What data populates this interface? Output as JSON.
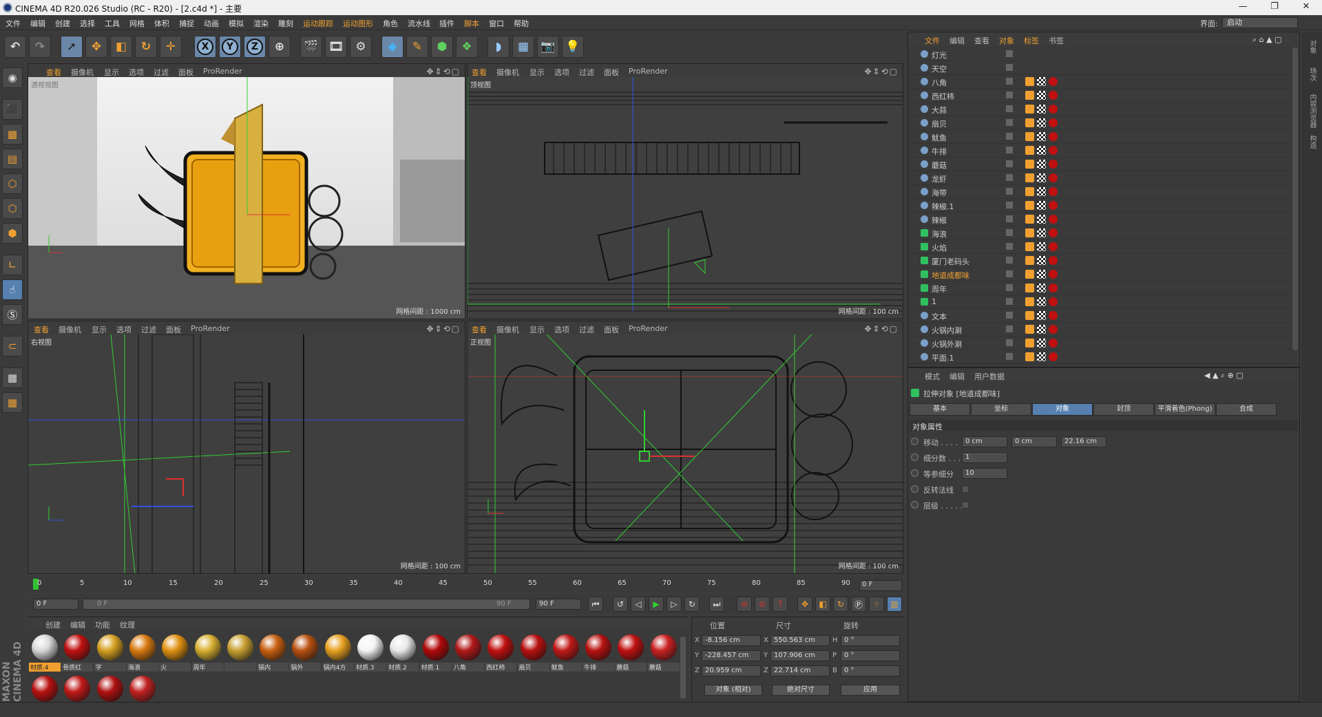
{
  "window": {
    "title": "CINEMA 4D R20.026 Studio (RC - R20) - [2.c4d *] - 主要",
    "minimize": "—",
    "maximize": "❐",
    "close": "✕"
  },
  "menu": [
    "文件",
    "编辑",
    "创建",
    "选择",
    "工具",
    "网格",
    "体积",
    "捕捉",
    "动画",
    "模拟",
    "渲染",
    "雕刻",
    "运动跟踪",
    "运动图形",
    "角色",
    "流水线",
    "插件",
    "脚本",
    "窗口",
    "帮助"
  ],
  "layout": {
    "label": "界面:",
    "value": "启动"
  },
  "toolbar": {
    "undo": "↶",
    "redo": "↷",
    "x": "X",
    "y": "Y",
    "z": "Z"
  },
  "viewport_menu": [
    "查看",
    "摄像机",
    "显示",
    "选项",
    "过滤",
    "面板",
    "ProRender"
  ],
  "viewports": [
    {
      "name": "透视视图",
      "grid": "网格间距 : 1000 cm"
    },
    {
      "name": "顶视图",
      "grid": "网格间距 : 100 cm"
    },
    {
      "name": "右视图",
      "grid": "网格间距 : 100 cm"
    },
    {
      "name": "正视图",
      "grid": "网格间距 : 100 cm"
    }
  ],
  "timeline": {
    "ticks": [
      "0",
      "5",
      "10",
      "15",
      "20",
      "25",
      "30",
      "35",
      "40",
      "45",
      "50",
      "55",
      "60",
      "65",
      "70",
      "75",
      "80",
      "85",
      "90"
    ],
    "current": "0 F"
  },
  "transport": {
    "start": "0 F",
    "slider_start": "0 F",
    "slider_end": "90 F",
    "end": "90 F"
  },
  "materials": {
    "menu": [
      "创建",
      "编辑",
      "功能",
      "纹理"
    ],
    "items": [
      {
        "label": "材质.4",
        "color": "#d8d8d8"
      },
      {
        "label": "骨质红",
        "color": "#c01010"
      },
      {
        "label": "字",
        "color": "#d4a020"
      },
      {
        "label": "海浪",
        "color": "#d87a10"
      },
      {
        "label": "火",
        "color": "#e09010"
      },
      {
        "label": "周年",
        "color": "#d8b030"
      },
      {
        "label": "",
        "color": "#c8a030"
      },
      {
        "label": "锅内",
        "color": "#c86010"
      },
      {
        "label": "锅外",
        "color": "#b85010"
      },
      {
        "label": "锅内4方",
        "color": "#e8a020"
      },
      {
        "label": "材质.3",
        "color": "#f4f4f4"
      },
      {
        "label": "材质.2",
        "color": "#e8e8e8"
      },
      {
        "label": "材质.1",
        "color": "#b00808"
      },
      {
        "label": "八角",
        "color": "#b01818"
      },
      {
        "label": "西红柿",
        "color": "#c01010"
      },
      {
        "label": "扇贝",
        "color": "#b81010"
      },
      {
        "label": "鱿鱼",
        "color": "#c01818"
      },
      {
        "label": "牛排",
        "color": "#b81010"
      },
      {
        "label": "蘑菇",
        "color": "#c01010"
      },
      {
        "label": "蘑菇",
        "color": "#c82020"
      }
    ],
    "row2": [
      {
        "label": "",
        "color": "#b81010"
      },
      {
        "label": "",
        "color": "#c01818"
      },
      {
        "label": "",
        "color": "#b01010"
      },
      {
        "label": "",
        "color": "#c02020"
      }
    ]
  },
  "coords": {
    "headers": [
      "位置",
      "尺寸",
      "旋转"
    ],
    "rows": [
      {
        "axis": "X",
        "pos": "-8.156 cm",
        "size_axis": "X",
        "size": "550.563 cm",
        "rot_axis": "H",
        "rot": "0 °"
      },
      {
        "axis": "Y",
        "pos": "-228.457 cm",
        "size_axis": "Y",
        "size": "107.906 cm",
        "rot_axis": "P",
        "rot": "0 °"
      },
      {
        "axis": "Z",
        "pos": "20.959 cm",
        "size_axis": "Z",
        "size": "22.714 cm",
        "rot_axis": "B",
        "rot": "0 °"
      }
    ],
    "mode": "对象 (相对)",
    "size_mode": "绝对尺寸",
    "apply": "应用"
  },
  "objmgr": {
    "menu": [
      "文件",
      "编辑",
      "查看",
      "对象",
      "标签",
      "书签"
    ],
    "rows": [
      {
        "name": "灯光"
      },
      {
        "name": "天空"
      },
      {
        "name": "八角"
      },
      {
        "name": "西红柿"
      },
      {
        "name": "大蒜"
      },
      {
        "name": "扇贝"
      },
      {
        "name": "鱿鱼"
      },
      {
        "name": "牛排"
      },
      {
        "name": "蘑菇"
      },
      {
        "name": "龙虾"
      },
      {
        "name": "海带"
      },
      {
        "name": "辣椒.1"
      },
      {
        "name": "辣椒"
      },
      {
        "name": "海浪"
      },
      {
        "name": "火焰"
      },
      {
        "name": "厦门老码头"
      },
      {
        "name": "地道成都味"
      },
      {
        "name": "周年"
      },
      {
        "name": "1"
      },
      {
        "name": "文本"
      },
      {
        "name": "火锅内涮"
      },
      {
        "name": "火锅外涮"
      },
      {
        "name": "平面.1"
      }
    ]
  },
  "attr": {
    "menu": [
      "模式",
      "编辑",
      "用户数据"
    ],
    "title": "拉伸对象 [地道成都味]",
    "tabs": [
      "基本",
      "坐标",
      "对象",
      "封顶",
      "平滑着色(Phong)",
      "合成"
    ],
    "section": "对象属性",
    "move_label": "移动 . . . .",
    "move": [
      "0 cm",
      "0 cm",
      "22.16 cm"
    ],
    "subdiv_label": "细分数 . . .",
    "subdiv": "1",
    "isoparm_label": "等参细分",
    "isoparm": "10",
    "flip_label": "反转法线",
    "hier_label": "层级 . . . . ."
  },
  "side_tabs": [
    "对象",
    "场次",
    "内容浏览器",
    "构造"
  ],
  "brand": "MAXON CINEMA 4D",
  "colors": {
    "accent": "#f0a030",
    "selected": "#5580b0"
  }
}
